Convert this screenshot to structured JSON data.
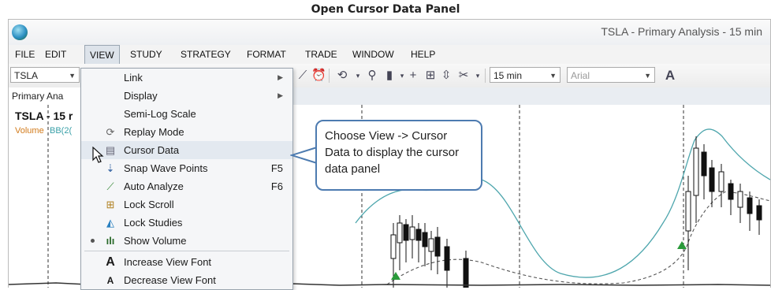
{
  "caption": "Open Cursor Data Panel",
  "window": {
    "title": "TSLA - Primary Analysis - 15 min"
  },
  "menubar": [
    "FILE",
    "EDIT",
    "VIEW",
    "STUDY",
    "STRATEGY",
    "FORMAT",
    "TRADE",
    "WINDOW",
    "HELP"
  ],
  "toolbar": {
    "symbol": "TSLA",
    "interval": "15 min",
    "font": "Arial"
  },
  "tab": {
    "label": "Primary Ana"
  },
  "chart": {
    "title": "TSLA - 15 r",
    "legend_volume": "Volume",
    "legend_bb": "BB(2("
  },
  "view_menu": {
    "items": [
      {
        "label": "Link",
        "submenu": true
      },
      {
        "label": "Display",
        "submenu": true
      },
      {
        "label": "Semi-Log Scale"
      },
      {
        "label": "Replay Mode",
        "icon": "replay-icon"
      },
      {
        "label": "Cursor Data",
        "icon": "cursor-data-icon",
        "highlighted": true
      },
      {
        "label": "Snap Wave Points",
        "icon": "snap-wave-icon",
        "shortcut": "F5"
      },
      {
        "label": "Auto Analyze",
        "icon": "auto-analyze-icon",
        "shortcut": "F6"
      },
      {
        "label": "Lock Scroll",
        "icon": "lock-scroll-icon"
      },
      {
        "label": "Lock Studies",
        "icon": "lock-studies-icon"
      },
      {
        "label": "Show Volume",
        "icon": "volume-icon",
        "checked": true
      },
      {
        "label": "Increase View Font",
        "icon": "increase-font-icon"
      },
      {
        "label": "Decrease View Font",
        "icon": "decrease-font-icon"
      }
    ]
  },
  "callout": {
    "text": "Choose View -> Cursor Data to display the cursor data panel"
  }
}
